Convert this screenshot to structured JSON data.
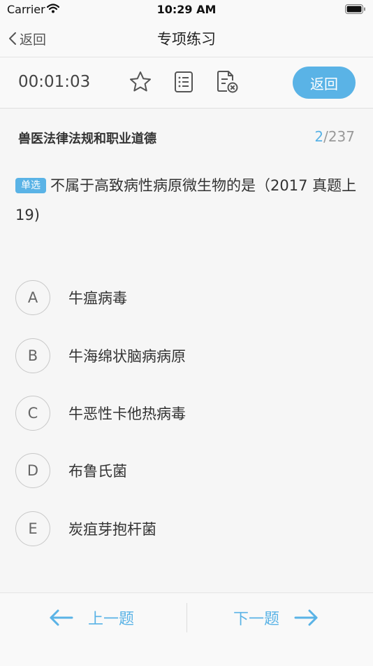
{
  "status_bar": {
    "carrier": "Carrier",
    "time": "10:29 AM"
  },
  "nav": {
    "back_label": "返回",
    "title": "专项练习"
  },
  "toolbar": {
    "timer": "00:01:03",
    "icons": [
      "star-icon",
      "list-icon",
      "clear-answers-icon"
    ],
    "return_label": "返回"
  },
  "question": {
    "subject": "兽医法律法规和职业道德",
    "current": "2",
    "total": "/237",
    "type_badge": "单选",
    "text": "不属于高致病性病原微生物的是（2017 真题上 19)",
    "options": [
      {
        "letter": "A",
        "text": "牛瘟病毒"
      },
      {
        "letter": "B",
        "text": "牛海绵状脑病病原"
      },
      {
        "letter": "C",
        "text": "牛恶性卡他热病毒"
      },
      {
        "letter": "D",
        "text": "布鲁氏菌"
      },
      {
        "letter": "E",
        "text": "炭疽芽抱杆菌"
      }
    ]
  },
  "footer": {
    "prev_label": "上一题",
    "next_label": "下一题"
  },
  "colors": {
    "accent": "#5ab3e6",
    "text": "#333333",
    "background": "#f6f6f6"
  }
}
